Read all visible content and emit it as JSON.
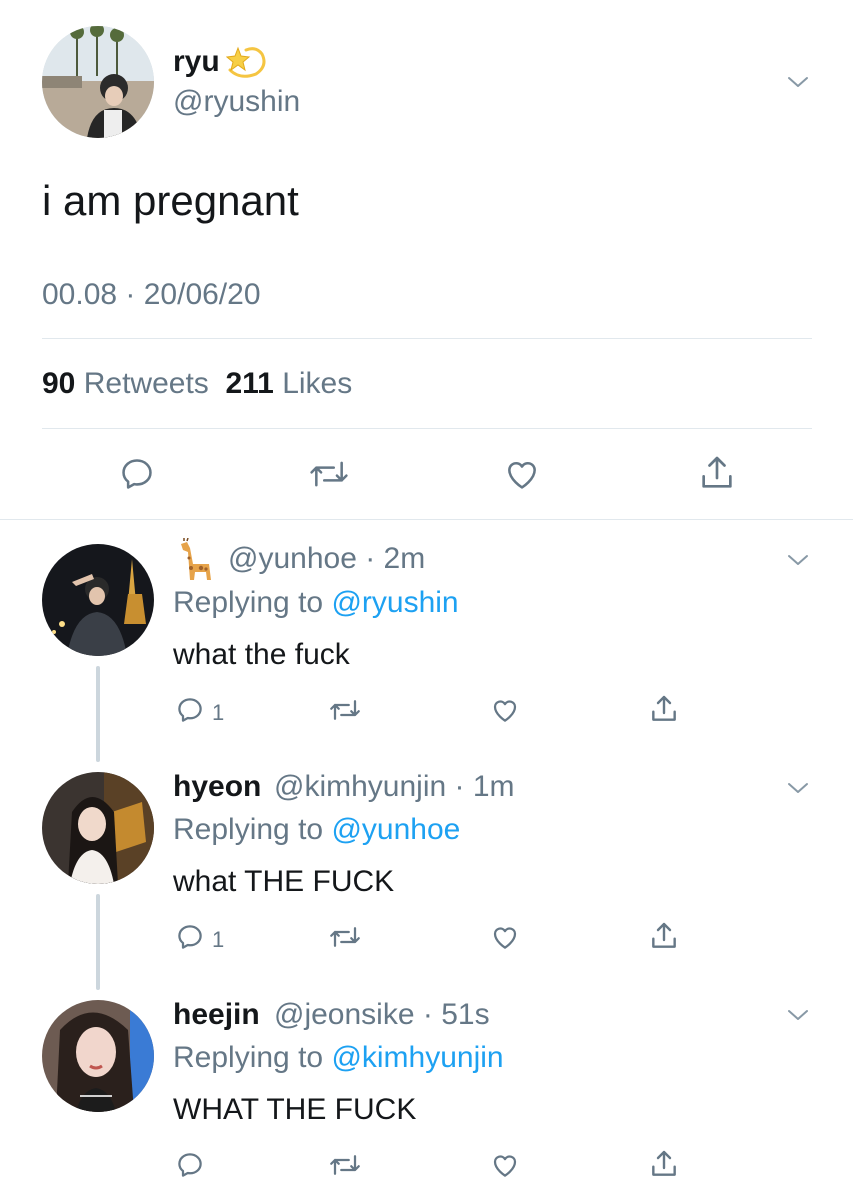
{
  "main_tweet": {
    "name": "ryu",
    "name_emoji": "dizzy-star-icon",
    "handle": "@ryushin",
    "text": "i am pregnant",
    "timestamp": "00.08 · 20/06/20",
    "retweet_count": "90",
    "retweet_label": "Retweets",
    "like_count": "211",
    "like_label": "Likes"
  },
  "replies": [
    {
      "name_emoji": "giraffe-icon",
      "handle": "@yunhoe",
      "time": "· 2m",
      "replying_prefix": "Replying to",
      "replying_to": "@ryushin",
      "text": "what the fuck",
      "reply_count": "1"
    },
    {
      "name": "hyeon",
      "handle": "@kimhyunjin",
      "time": "· 1m",
      "replying_prefix": "Replying to",
      "replying_to": "@yunhoe",
      "text": "what THE FUCK",
      "reply_count": "1"
    },
    {
      "name": "heejin",
      "handle": "@jeonsike",
      "time": "· 51s",
      "replying_prefix": "Replying to",
      "replying_to": "@kimhyunjin",
      "text": "WHAT THE FUCK",
      "reply_count": ""
    }
  ],
  "colors": {
    "text_primary": "#14171a",
    "text_secondary": "#657786",
    "link": "#1da1f2",
    "divider": "#e1e8ed",
    "thread_line": "#ccd6dd",
    "icon": "#657786"
  }
}
